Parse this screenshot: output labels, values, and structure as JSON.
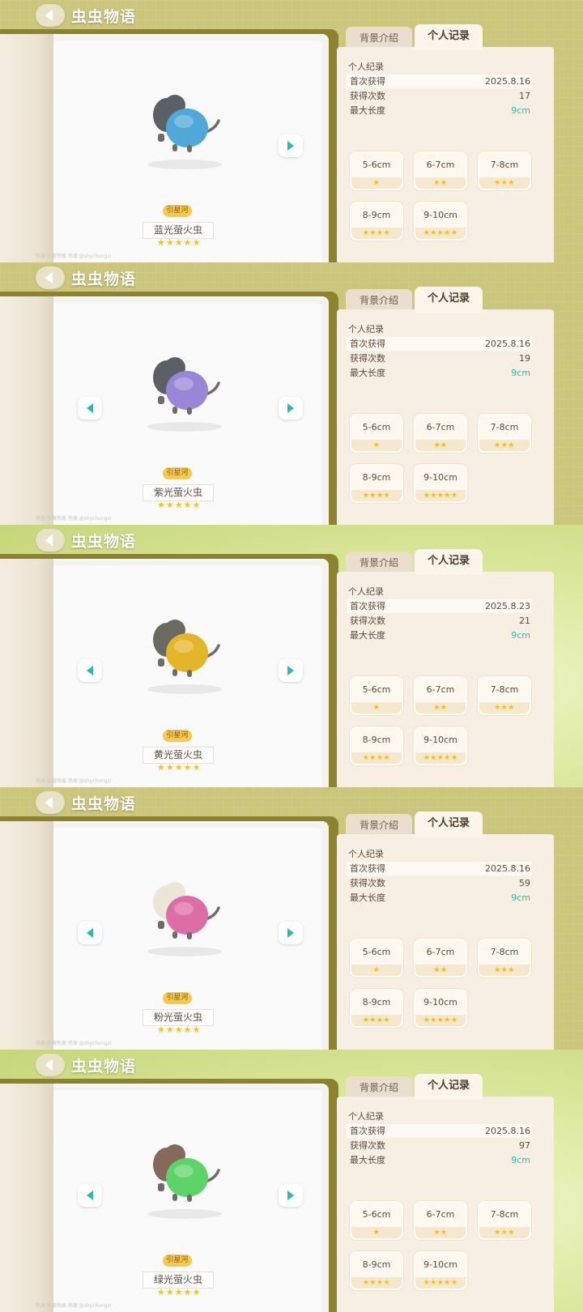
{
  "app_title": "虫虫物语",
  "tabs": {
    "background": "背景介绍",
    "record": "个人记录"
  },
  "record_labels": {
    "section": "个人纪录",
    "first_obtained": "首次获得",
    "times_obtained": "获得次数",
    "max_length": "最大长度"
  },
  "size_classes": [
    {
      "label": "5-6cm",
      "stars": "★"
    },
    {
      "label": "6-7cm",
      "stars": "★★"
    },
    {
      "label": "7-8cm",
      "stars": "★★★"
    },
    {
      "label": "8-9cm",
      "stars": "★★★★"
    },
    {
      "label": "9-10cm",
      "stars": "★★★★★"
    }
  ],
  "rarity_tag": "引星河",
  "rarity_stars": "★★★★★",
  "footer_tiny": "热搜  热搜热搜  热搜  @shychongzi",
  "colors": {
    "teal": "#2fb8b0",
    "star": "#f5c02a",
    "tag": "#f6c94f"
  },
  "screens": [
    {
      "name": "蓝光萤火虫",
      "first": "2025.8.16",
      "count": "17",
      "max_len": "9cm",
      "body_color": "#4fa8d8",
      "wing_color": "#5b6066",
      "has_prev": false,
      "glow": false
    },
    {
      "name": "紫光萤火虫",
      "first": "2025.8.16",
      "count": "19",
      "max_len": "9cm",
      "body_color": "#9a86d6",
      "wing_color": "#5b6066",
      "has_prev": true,
      "glow": false
    },
    {
      "name": "黄光萤火虫",
      "first": "2025.8.23",
      "count": "21",
      "max_len": "9cm",
      "body_color": "#e3b62a",
      "wing_color": "#6c6a60",
      "has_prev": true,
      "glow": true
    },
    {
      "name": "粉光萤火虫",
      "first": "2025.8.16",
      "count": "59",
      "max_len": "9cm",
      "body_color": "#dc6da6",
      "wing_color": "#ece6d6",
      "has_prev": true,
      "glow": false
    },
    {
      "name": "绿光萤火虫",
      "first": "2025.8.16",
      "count": "97",
      "max_len": "9cm",
      "body_color": "#5ed36a",
      "wing_color": "#85695a",
      "has_prev": true,
      "glow": true
    }
  ]
}
